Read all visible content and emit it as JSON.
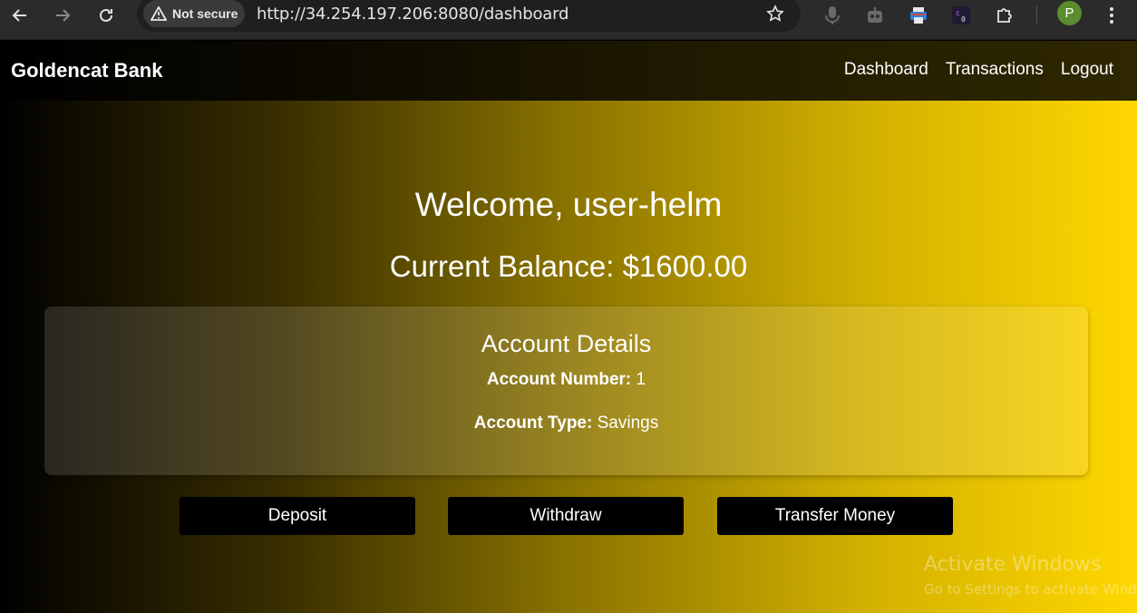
{
  "browser": {
    "security_label": "Not secure",
    "url": "http://34.254.197.206:8080/dashboard",
    "profile_initial": "P"
  },
  "site": {
    "brand": "Goldencat Bank",
    "nav": [
      "Dashboard",
      "Transactions",
      "Logout"
    ]
  },
  "dashboard": {
    "welcome": "Welcome, user-helm",
    "balance": "Current Balance: $1600.00"
  },
  "account": {
    "title": "Account Details",
    "number_label": "Account Number:",
    "number_value": "1",
    "type_label": "Account Type:",
    "type_value": "Savings"
  },
  "actions": {
    "deposit": "Deposit",
    "withdraw": "Withdraw",
    "transfer": "Transfer Money"
  },
  "watermark": {
    "title": "Activate Windows",
    "subtitle": "Go to Settings to activate Windows."
  },
  "colors": {
    "gradient_start": "#000000",
    "gradient_end": "#ffd700",
    "button_bg": "#000000"
  },
  "icons": [
    "back-arrow-icon",
    "forward-arrow-icon",
    "reload-icon",
    "warning-icon",
    "star-icon",
    "microphone-icon",
    "robot-icon",
    "printer-icon",
    "extension-icon",
    "puzzle-icon",
    "more-vert-icon"
  ]
}
